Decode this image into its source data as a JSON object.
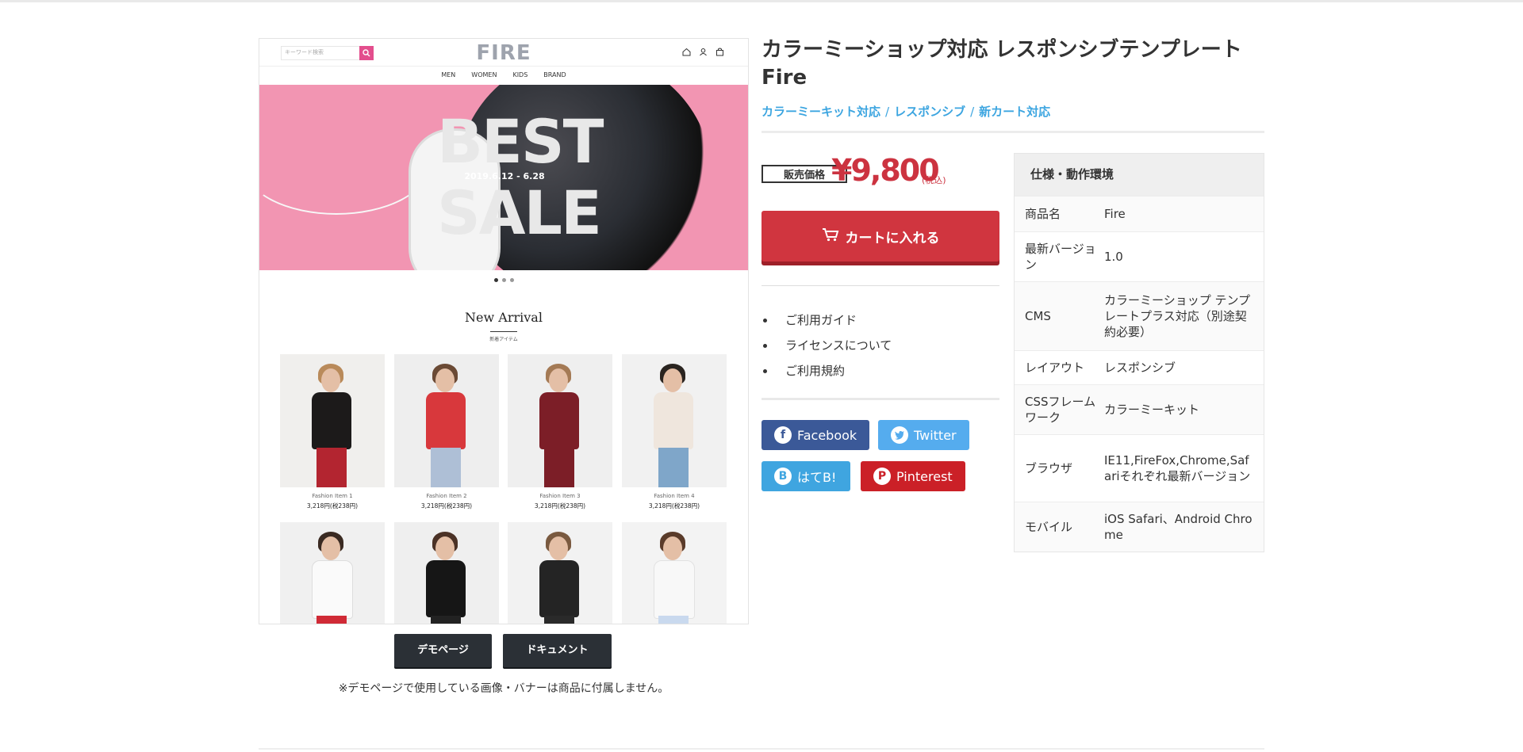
{
  "preview": {
    "search_placeholder": "キーワード検索",
    "logo": "FIRE",
    "nav": [
      "MEN",
      "WOMEN",
      "KIDS",
      "BRAND"
    ],
    "banner": {
      "headline_top": "BEST",
      "date": "2019.6.12 - 6.28",
      "headline_bottom": "SALE"
    },
    "section_title": "New Arrival",
    "section_subtitle": "新着アイテム",
    "items": [
      {
        "name": "Fashion Item 1",
        "price": "3,218円(税238円)"
      },
      {
        "name": "Fashion Item 2",
        "price": "3,218円(税238円)"
      },
      {
        "name": "Fashion Item 3",
        "price": "3,218円(税238円)"
      },
      {
        "name": "Fashion Item 4",
        "price": "3,218円(税238円)"
      }
    ]
  },
  "demo": {
    "demo_label": "デモページ",
    "doc_label": "ドキュメント",
    "note": "※デモページで使用している画像・バナーは商品に付属しません。"
  },
  "product": {
    "title": "カラーミーショップ対応 レスポンシブテンプレート Fire",
    "categories": [
      "カラーミーキット対応",
      "レスポンシブ",
      "新カート対応"
    ],
    "category_sep": "/",
    "price_label": "販売価格",
    "price": "¥9,800",
    "tax_note": "(税込)",
    "cart_label": "カートに入れる",
    "links": [
      "ご利用ガイド",
      "ライセンスについて",
      "ご利用規約"
    ]
  },
  "share": {
    "facebook": "Facebook",
    "twitter": "Twitter",
    "hatena": "はてB!",
    "pinterest": "Pinterest"
  },
  "spec": {
    "title": "仕様・動作環境",
    "rows": [
      {
        "key": "商品名",
        "value": "Fire"
      },
      {
        "key": "最新バージョン",
        "value": "1.0"
      },
      {
        "key": "CMS",
        "value": "カラーミーショップ テンプレートプラス対応（別途契約必要）"
      },
      {
        "key": "レイアウト",
        "value": "レスポンシブ"
      },
      {
        "key": "CSSフレームワーク",
        "value": "カラーミーキット"
      },
      {
        "key": "ブラウザ",
        "value": "IE11,FireFox,Chrome,Safariそれぞれ最新バージョン"
      },
      {
        "key": "モバイル",
        "value": "iOS Safari、Android Chrome"
      }
    ]
  },
  "colors": {
    "accent": "#d0353f",
    "link": "#3ca5e0",
    "facebook": "#3b5998",
    "twitter": "#55acee",
    "hatena": "#3fa5e0",
    "pinterest": "#cb2027",
    "dark_button": "#2b3036"
  }
}
